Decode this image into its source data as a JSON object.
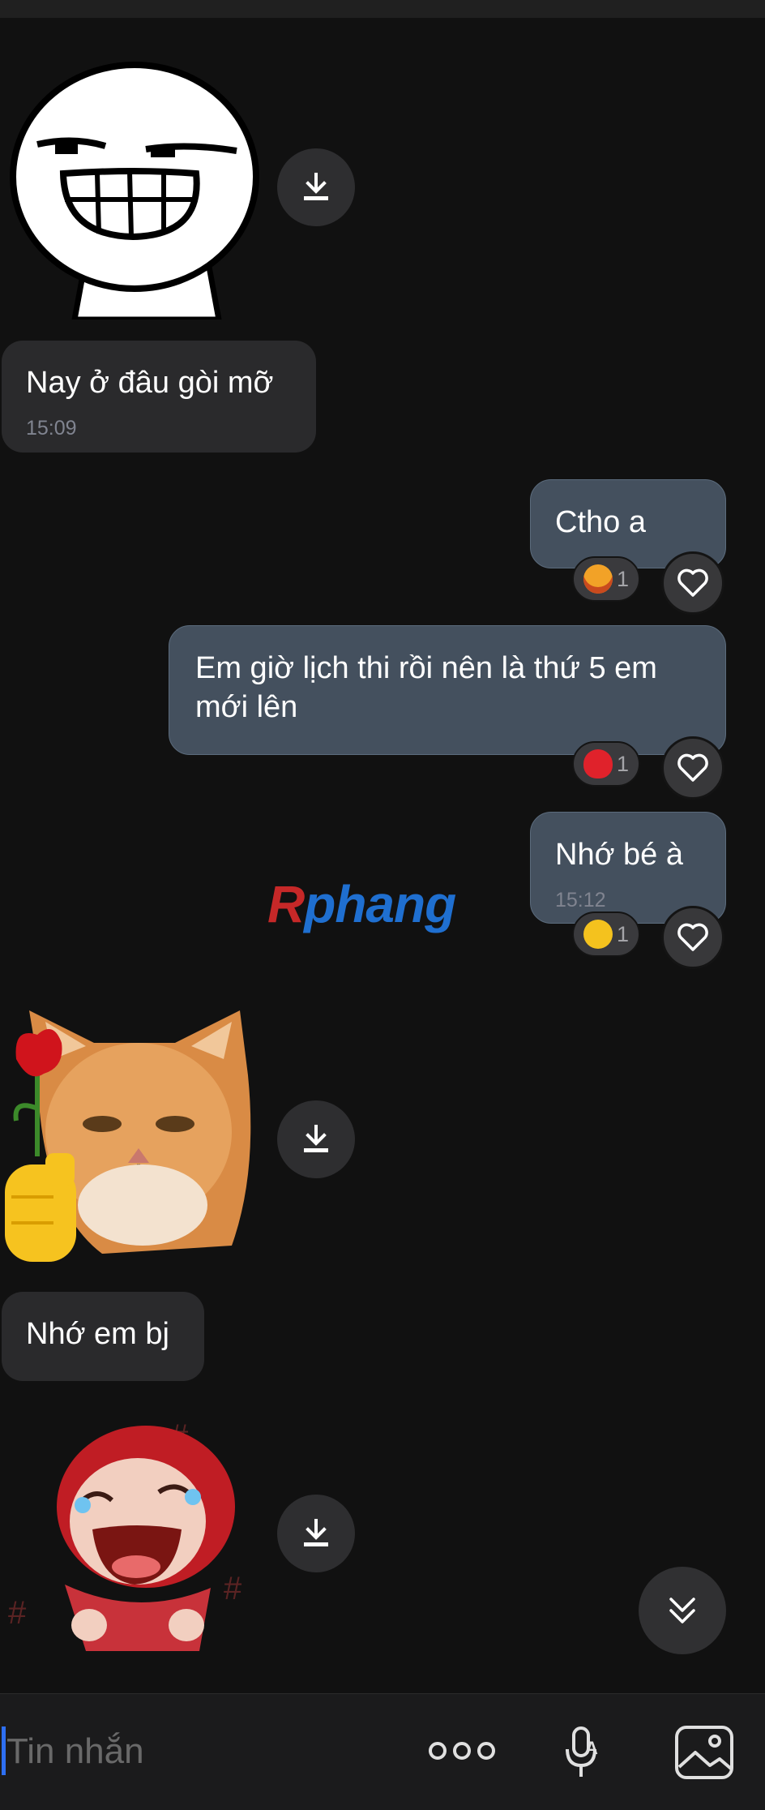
{
  "messages": {
    "m1_text": "Nay ở đâu gòi mỡ",
    "m1_time": "15:09",
    "m2_text": "Ctho a",
    "m2_reaction_count": "1",
    "m3_text": "Em giờ lịch thi rồi nên là thứ 5 em mới lên",
    "m3_reaction_count": "1",
    "m4_text": "Nhớ bé à",
    "m4_time": "15:12",
    "m4_reaction_count": "1",
    "m5_text": "Nhớ em bj"
  },
  "watermark": {
    "part1": "R",
    "part2": "phang"
  },
  "composer": {
    "placeholder": "Tin nhắn"
  },
  "stickers": [
    "smug-face-sticker",
    "cat-rose-sticker",
    "laughing-hood-sticker"
  ],
  "icons": [
    "download-icon",
    "heart-icon",
    "more-icon",
    "voice-icon",
    "image-icon",
    "chevrons-down-icon"
  ],
  "colors": {
    "background": "#111111",
    "incoming_bubble": "#2a2a2c",
    "outgoing_bubble": "#44505e",
    "accent": "#2e6ff2"
  }
}
